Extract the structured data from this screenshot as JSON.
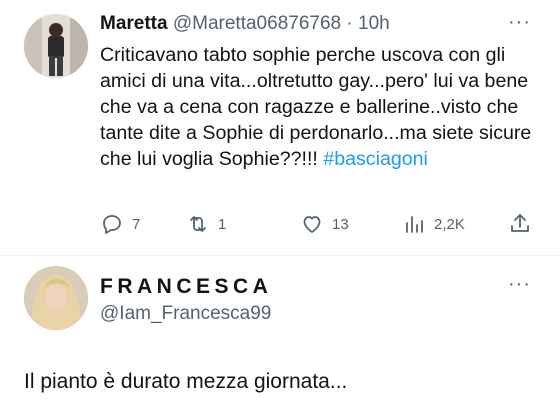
{
  "tweet1": {
    "author_name": "Maretta",
    "author_handle": "@Maretta06876768",
    "separator": " · ",
    "time": "10h",
    "text": "Criticavano tabto sophie perche uscova con gli amici di una vita...oltretutto gay...pero' lui va bene che va a cena con ragazze e ballerine..visto che tante dite a Sophie di perdonarlo...ma siete sicure che lui voglia Sophie??!!! ",
    "hashtag": "#basciagoni",
    "metrics": {
      "replies": "7",
      "retweets": "1",
      "likes": "13",
      "views": "2,2K"
    }
  },
  "tweet2": {
    "author_name": "FRANCESCA",
    "author_handle": "@Iam_Francesca99",
    "text": "Il pianto è durato mezza giornata..."
  },
  "icons": {
    "more": "more-horizontal-icon",
    "reply": "reply-icon",
    "retweet": "retweet-icon",
    "like": "heart-icon",
    "views": "views-chart-icon",
    "share": "share-icon"
  },
  "colors": {
    "text": "#0f1419",
    "secondary": "#536471",
    "link": "#1d9bf0",
    "divider": "#eff3f4"
  }
}
